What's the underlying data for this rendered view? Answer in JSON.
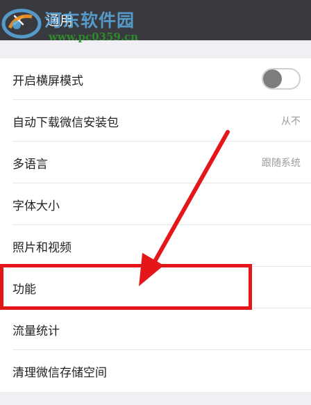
{
  "header": {
    "title": "通用",
    "back_icon": "close-icon"
  },
  "watermark": {
    "title": "河东软件园",
    "url": "www.pc0359.cn"
  },
  "settings": {
    "items": [
      {
        "label": "开启横屏模式",
        "toggle": "off"
      },
      {
        "label": "自动下载微信安装包",
        "value": "从不"
      },
      {
        "label": "多语言",
        "value": "跟随系统"
      },
      {
        "label": "字体大小"
      },
      {
        "label": "照片和视频"
      },
      {
        "label": "功能"
      },
      {
        "label": "流量统计"
      },
      {
        "label": "清理微信存储空间"
      }
    ]
  },
  "annotation": {
    "highlight_color": "#e5161a",
    "highlighted_item": "功能"
  }
}
